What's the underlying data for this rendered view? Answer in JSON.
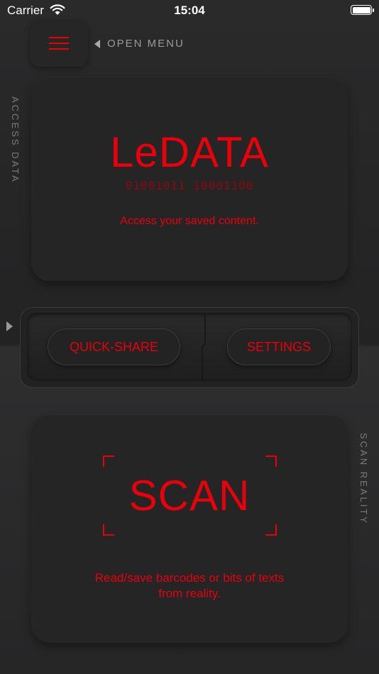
{
  "status_bar": {
    "carrier": "Carrier",
    "time": "15:04"
  },
  "menu": {
    "open_menu_label": "OPEN MENU"
  },
  "side_labels": {
    "left": "ACCESS DATA",
    "right": "SCAN REALITY"
  },
  "access_card": {
    "title": "LeDATA",
    "binary": "01001011 10001100",
    "description": "Access your saved content."
  },
  "tray": {
    "quick_share_label": "QUICK-SHARE",
    "settings_label": "SETTINGS"
  },
  "scan_card": {
    "title": "SCAN",
    "description_line1": "Read/save barcodes or bits of texts",
    "description_line2": "from reality."
  },
  "colors": {
    "accent": "#e8000b",
    "background": "#262627",
    "muted_text": "#9a9a9a"
  }
}
